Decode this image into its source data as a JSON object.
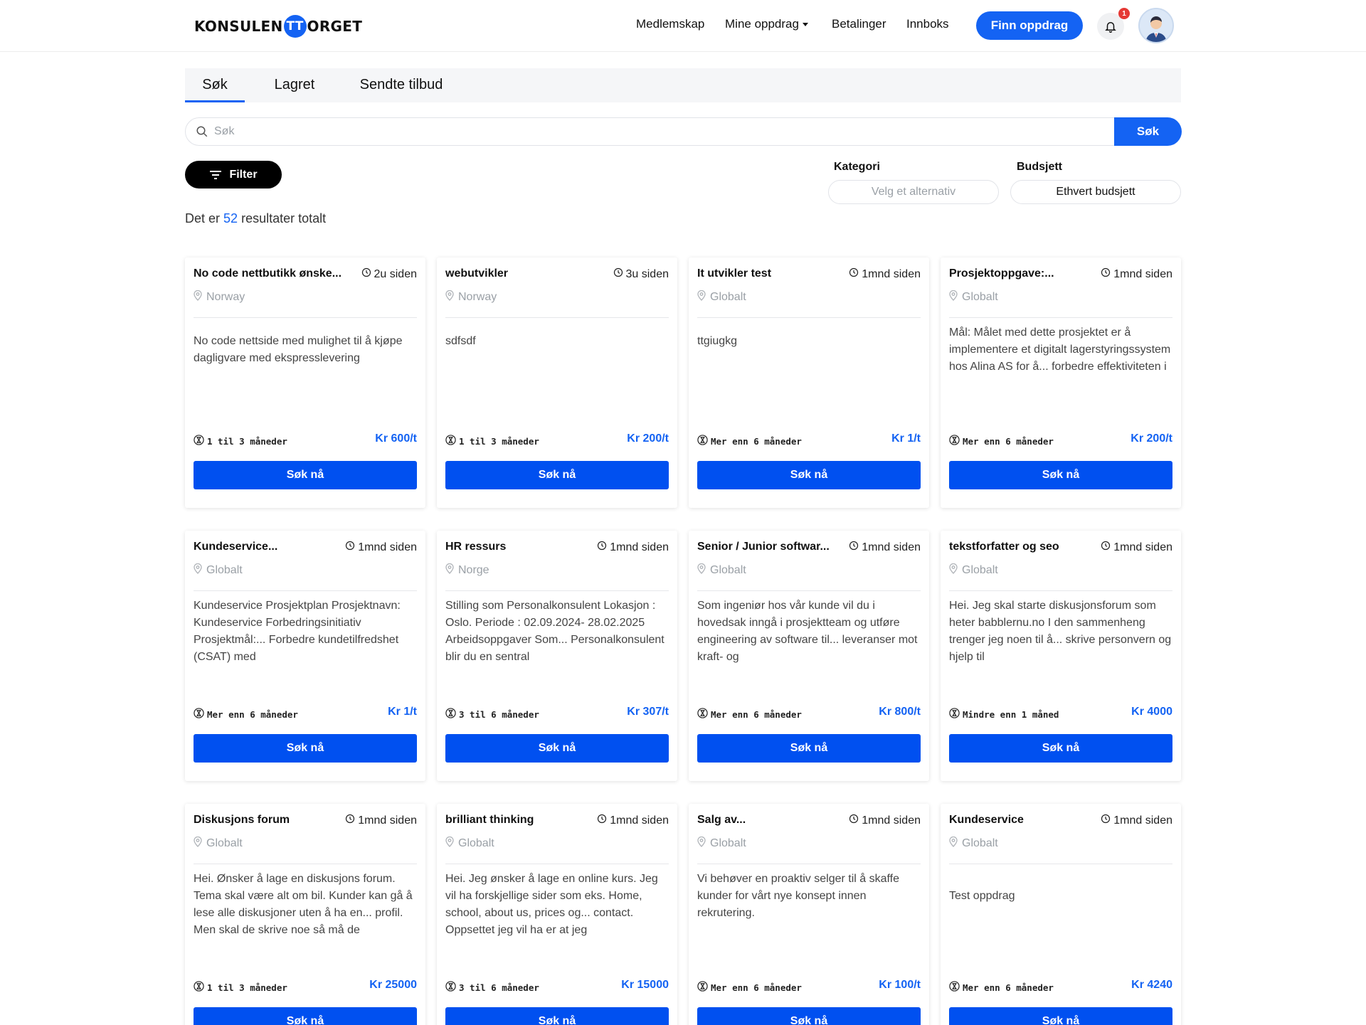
{
  "header": {
    "logo_left": "KONSULEN",
    "logo_mid": "TT",
    "logo_right": "ORGET",
    "nav": [
      "Medlemskap",
      "Mine oppdrag",
      "Betalinger",
      "Innboks"
    ],
    "cta": "Finn oppdrag",
    "notification_count": "1"
  },
  "tabs": [
    "Søk",
    "Lagret",
    "Sendte tilbud"
  ],
  "search": {
    "placeholder": "Søk",
    "button": "Søk"
  },
  "filter": {
    "button": "Filter",
    "kategori_label": "Kategori",
    "kategori_value": "Velg et alternativ",
    "budsjett_label": "Budsjett",
    "budsjett_value": "Ethvert budsjett"
  },
  "results": {
    "prefix": "Det er",
    "count": "52",
    "suffix": "resultater totalt"
  },
  "apply_label": "Søk nå",
  "cards": [
    {
      "title": "No code nettbutikk ønske...",
      "time": "2u siden",
      "location": "Norway",
      "desc": "No code nettside med mulighet til å kjøpe dagligvare med ekspresslevering",
      "duration": "1 til 3 måneder",
      "price": "Kr 600/t"
    },
    {
      "title": "webutvikler",
      "time": "3u siden",
      "location": "Norway",
      "desc": "sdfsdf",
      "duration": "1 til 3 måneder",
      "price": "Kr 200/t"
    },
    {
      "title": "It utvikler test",
      "time": "1mnd siden",
      "location": "Globalt",
      "desc": "ttgiugkg",
      "duration": "Mer enn 6 måneder",
      "price": "Kr 1/t"
    },
    {
      "title": "Prosjektoppgave:...",
      "time": "1mnd siden",
      "location": "Globalt",
      "desc": "Mål: Målet med dette prosjektet er å implementere et digitalt lagerstyringssystem hos Alina AS for å... forbedre effektiviteten i",
      "duration": "Mer enn 6 måneder",
      "price": "Kr 200/t"
    },
    {
      "title": "Kundeservice...",
      "time": "1mnd siden",
      "location": "Globalt",
      "desc": "Kundeservice Prosjektplan Prosjektnavn: Kundeservice Forbedringsinitiativ Prosjektmål:... Forbedre kundetilfredshet (CSAT) med",
      "duration": "Mer enn 6 måneder",
      "price": "Kr 1/t"
    },
    {
      "title": "HR ressurs",
      "time": "1mnd siden",
      "location": "Norge",
      "desc": "Stilling som Personalkonsulent Lokasjon : Oslo. Periode : 02.09.2024- 28.02.2025 Arbeidsoppgaver Som... Personalkonsulent blir du en sentral",
      "duration": "3 til 6 måneder",
      "price": "Kr 307/t"
    },
    {
      "title": "Senior / Junior softwar...",
      "time": "1mnd siden",
      "location": "Globalt",
      "desc": "Som ingeniør hos vår kunde vil du i hovedsak inngå i prosjektteam og utføre engineering av software til... leveranser mot kraft- og",
      "duration": "Mer enn 6 måneder",
      "price": "Kr 800/t"
    },
    {
      "title": "tekstforfatter og seo",
      "time": "1mnd siden",
      "location": "Globalt",
      "desc": "Hei. Jeg skal starte diskusjonsforum som heter babblernu.no I den sammenheng trenger jeg noen til å... skrive personvern og hjelp til",
      "duration": "Mindre enn 1 måned",
      "price": "Kr 4000"
    },
    {
      "title": "Diskusjons forum",
      "time": "1mnd siden",
      "location": "Globalt",
      "desc": "Hei. Ønsker å lage en diskusjons forum. Tema skal være alt om bil. Kunder kan gå å lese alle diskusjoner uten å ha en... profil. Men skal de skrive noe så må de",
      "duration": "1 til 3 måneder",
      "price": "Kr 25000"
    },
    {
      "title": "brilliant thinking",
      "time": "1mnd siden",
      "location": "Globalt",
      "desc": "Hei. Jeg ønsker å lage en online kurs. Jeg vil ha forskjellige sider som eks. Home, school, about us, prices og... contact. Oppsettet jeg vil ha er at jeg",
      "duration": "3 til 6 måneder",
      "price": "Kr 15000"
    },
    {
      "title": "Salg av...",
      "time": "1mnd siden",
      "location": "Globalt",
      "desc": "Vi behøver en proaktiv selger til å skaffe kunder for vårt nye konsept innen rekrutering.",
      "duration": "Mer enn 6 måneder",
      "price": "Kr 100/t"
    },
    {
      "title": "Kundeservice",
      "time": "1mnd siden",
      "location": "Globalt",
      "desc": "Test oppdrag",
      "duration": "Mer enn 6 måneder",
      "price": "Kr 4240"
    }
  ]
}
